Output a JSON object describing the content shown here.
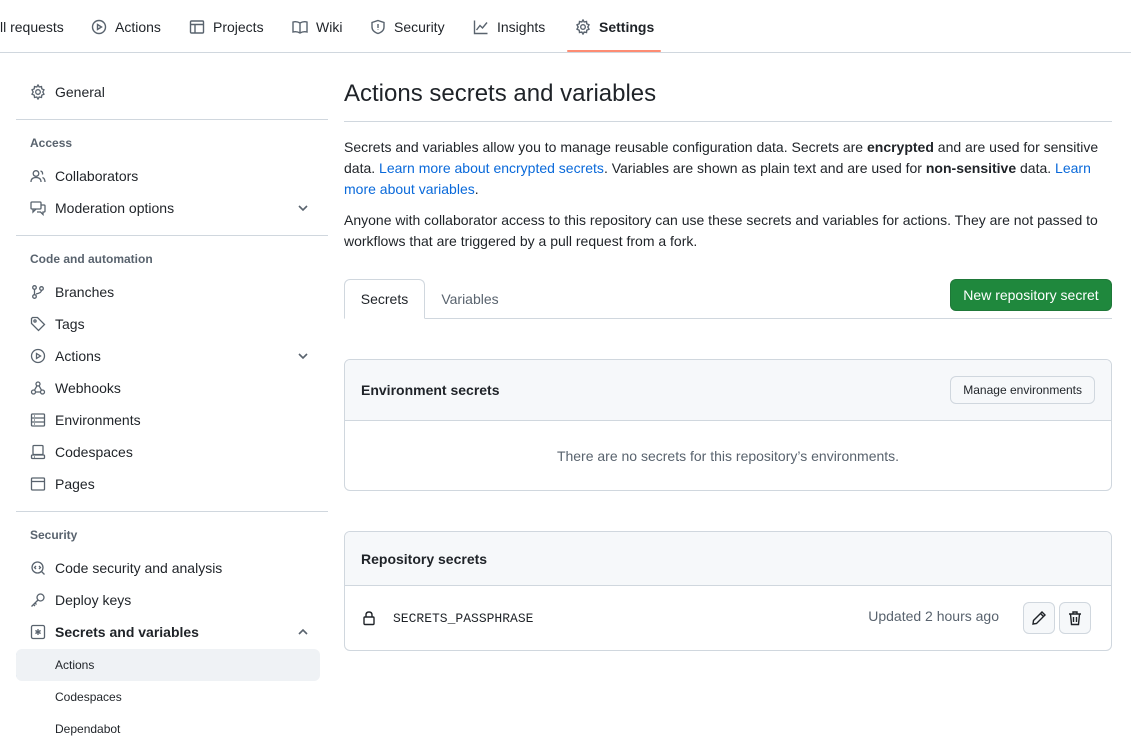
{
  "topnav": {
    "tabs": [
      {
        "label": "ll requests"
      },
      {
        "label": "Actions",
        "icon": "play-circle-icon"
      },
      {
        "label": "Projects",
        "icon": "table-icon"
      },
      {
        "label": "Wiki",
        "icon": "book-icon"
      },
      {
        "label": "Security",
        "icon": "shield-icon"
      },
      {
        "label": "Insights",
        "icon": "graph-icon"
      },
      {
        "label": "Settings",
        "icon": "gear-icon",
        "active": true
      }
    ],
    "accent_color": "#fd8c73"
  },
  "sidebar": {
    "general": "General",
    "sections": [
      {
        "heading": "Access",
        "items": [
          "Collaborators",
          "Moderation options"
        ]
      },
      {
        "heading": "Code and automation",
        "items": [
          "Branches",
          "Tags",
          "Actions",
          "Webhooks",
          "Environments",
          "Codespaces",
          "Pages"
        ]
      },
      {
        "heading": "Security",
        "items": [
          "Code security and analysis",
          "Deploy keys",
          "Secrets and variables"
        ]
      }
    ],
    "sub_items": [
      "Actions",
      "Codespaces",
      "Dependabot"
    ],
    "active_color": "#0969da"
  },
  "main": {
    "title": "Actions secrets and variables",
    "intro": {
      "t1": "Secrets and variables allow you to manage reusable configuration data. Secrets are ",
      "b1": "encrypted",
      "t2": " and are used for sensitive data. ",
      "link1": "Learn more about encrypted secrets",
      "t3": ". Variables are shown as plain text and are used for ",
      "b2": "non-sensitive",
      "t4": " data. ",
      "link2": "Learn more about variables",
      "t5": "."
    },
    "intro2": "Anyone with collaborator access to this repository can use these secrets and variables for actions. They are not passed to workflows that are triggered by a pull request from a fork.",
    "tabs": [
      "Secrets",
      "Variables"
    ],
    "new_secret_button": "New repository secret",
    "primary_color": "#1f883d",
    "environment_secrets": {
      "title": "Environment secrets",
      "manage_button": "Manage environments",
      "empty_text": "There are no secrets for this repository’s environments."
    },
    "repository_secrets": {
      "title": "Repository secrets",
      "rows": [
        {
          "name": "SECRETS_PASSPHRASE",
          "updated": "Updated 2 hours ago"
        }
      ]
    }
  }
}
